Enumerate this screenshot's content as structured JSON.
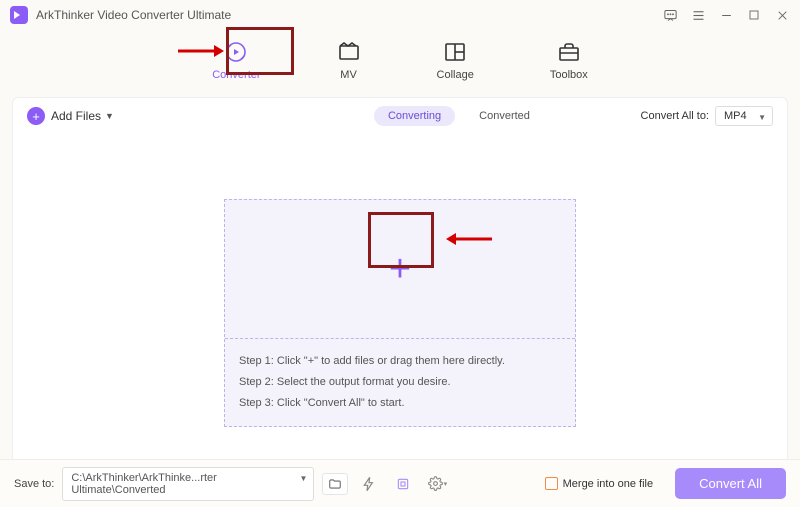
{
  "title": "ArkThinker Video Converter Ultimate",
  "tabs": {
    "converter": "Converter",
    "mv": "MV",
    "collage": "Collage",
    "toolbox": "Toolbox"
  },
  "toolbar": {
    "add_files": "Add Files",
    "converting": "Converting",
    "converted": "Converted",
    "convert_all_to": "Convert All to:",
    "format": "MP4"
  },
  "steps": {
    "s1": "Step 1: Click \"+\" to add files or drag them here directly.",
    "s2": "Step 2: Select the output format you desire.",
    "s3": "Step 3: Click \"Convert All\" to start."
  },
  "bottom": {
    "save_to": "Save to:",
    "path": "C:\\ArkThinker\\ArkThinke...rter Ultimate\\Converted",
    "merge": "Merge into one file",
    "convert_all": "Convert All"
  }
}
